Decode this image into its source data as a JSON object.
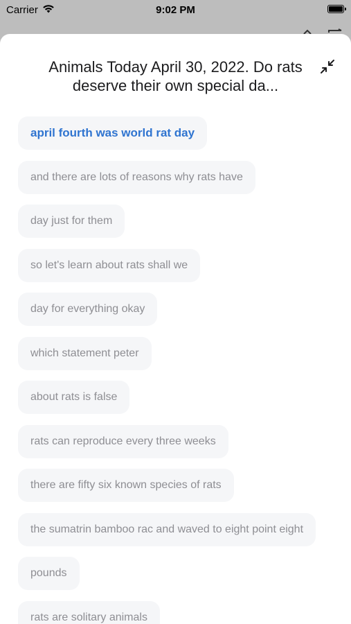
{
  "status_bar": {
    "carrier": "Carrier",
    "time": "9:02 PM"
  },
  "sheet": {
    "title": "Animals Today April 30, 2022. Do rats deserve their own special da..."
  },
  "transcript": [
    "april fourth was world rat day",
    "and there are lots of reasons why rats have",
    "day just for them",
    "so let's learn about rats shall we",
    "day for everything okay",
    "which statement peter",
    "about rats is false",
    "rats can reproduce every three weeks",
    "there are fifty six known species of rats",
    "the sumatrin bamboo rac and waved to eight point eight",
    "pounds",
    "rats are solitary animals"
  ],
  "colors": {
    "accent": "#2f74d0",
    "chip_bg": "#f5f6f8",
    "chip_text": "#8e8e93"
  },
  "icons": {
    "wifi": "wifi-icon",
    "battery": "battery-icon",
    "collapse": "collapse-icon"
  }
}
